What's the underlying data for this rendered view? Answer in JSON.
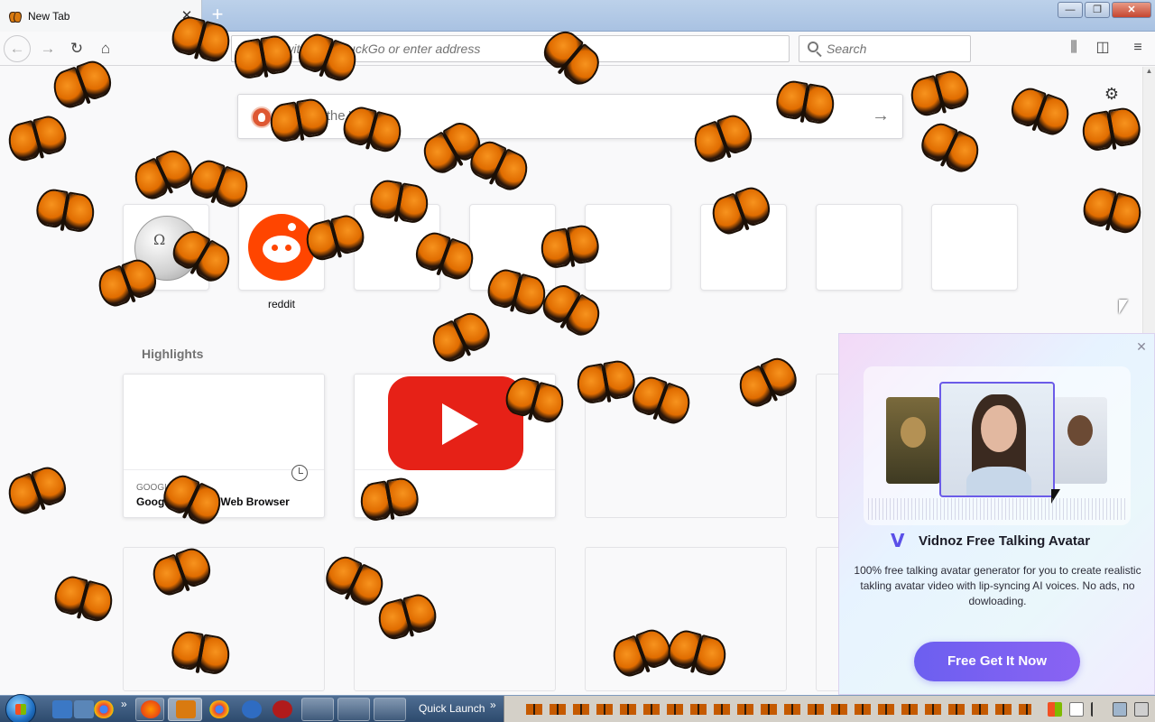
{
  "browser": {
    "tab_title": "New Tab",
    "new_tab_symbol": "+",
    "tab_close_symbol": "✕",
    "url_placeholder": "Search with DuckDuckGo or enter address",
    "search_placeholder": "Search",
    "window_controls": [
      "—",
      "❐",
      "✕"
    ]
  },
  "newtab": {
    "search_placeholder": "Search the Web",
    "top_sites": [
      {
        "label": ""
      },
      {
        "label": "reddit"
      },
      {
        "label": ""
      },
      {
        "label": ""
      },
      {
        "label": ""
      },
      {
        "label": ""
      },
      {
        "label": ""
      },
      {
        "label": ""
      }
    ],
    "highlights_title": "Highlights",
    "highlights": [
      {
        "source": "GOOGLE",
        "title": "Google Chrome Web Browser"
      },
      {
        "source": "YOUTUBE",
        "title": "YouTube"
      }
    ]
  },
  "popup": {
    "close_symbol": "✕",
    "title": "Vidnoz Free Talking Avatar",
    "description": "100% free talking avatar generator for you to create realistic takling avatar video with lip-syncing AI voices. No ads, no dowloading.",
    "cta": "Free Get It Now"
  },
  "taskbar": {
    "quick_launch_label": "Quick Launch",
    "chevron": "»"
  },
  "icons": {
    "back": "back-arrow-icon",
    "forward": "forward-arrow-icon",
    "reload": "reload-icon",
    "home": "home-icon",
    "library": "library-icon",
    "sidebar": "sidebar-icon",
    "menu": "hamburger-menu-icon",
    "settings": "gear-icon",
    "decorative_overlay": "butterfly-icon"
  }
}
